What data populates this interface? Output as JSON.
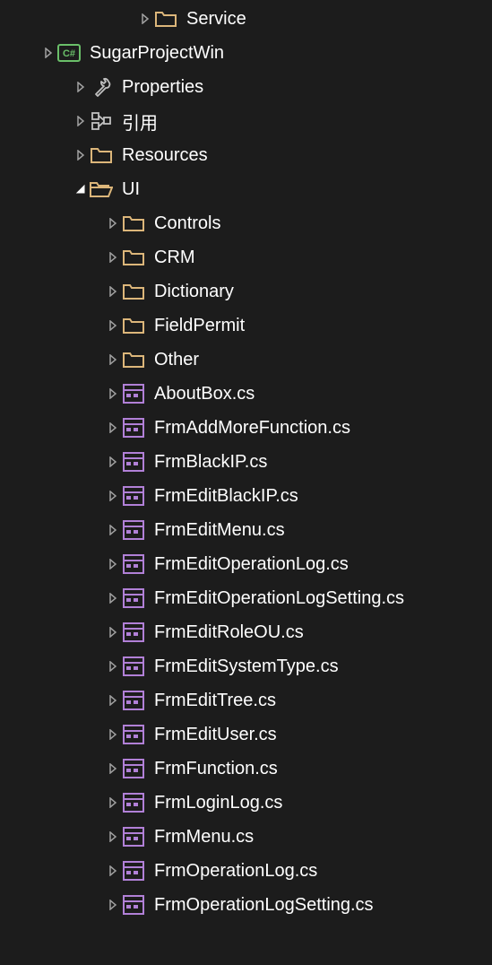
{
  "colors": {
    "folder": "#dcb67a",
    "purple": "#b180d7",
    "green": "#6abf69",
    "gray": "#c0c0c0",
    "white": "#ffffff",
    "arrow": "#a0a0a0"
  },
  "tree": [
    {
      "indent": 4,
      "expander": "right",
      "icon": "folder",
      "label": "Service",
      "name": "folder-service"
    },
    {
      "indent": 1,
      "expander": "right",
      "icon": "csproj",
      "label": "SugarProjectWin",
      "name": "project-sugarprojectwin"
    },
    {
      "indent": 2,
      "expander": "right",
      "icon": "wrench",
      "label": "Properties",
      "name": "folder-properties"
    },
    {
      "indent": 2,
      "expander": "right",
      "icon": "references",
      "label": "引用",
      "name": "folder-references"
    },
    {
      "indent": 2,
      "expander": "right",
      "icon": "folder",
      "label": "Resources",
      "name": "folder-resources"
    },
    {
      "indent": 2,
      "expander": "down",
      "icon": "folder-open",
      "label": "UI",
      "name": "folder-ui"
    },
    {
      "indent": 3,
      "expander": "right",
      "icon": "folder",
      "label": "Controls",
      "name": "folder-controls"
    },
    {
      "indent": 3,
      "expander": "right",
      "icon": "folder",
      "label": "CRM",
      "name": "folder-crm"
    },
    {
      "indent": 3,
      "expander": "right",
      "icon": "folder",
      "label": "Dictionary",
      "name": "folder-dictionary"
    },
    {
      "indent": 3,
      "expander": "right",
      "icon": "folder",
      "label": "FieldPermit",
      "name": "folder-fieldpermit"
    },
    {
      "indent": 3,
      "expander": "right",
      "icon": "folder",
      "label": "Other",
      "name": "folder-other"
    },
    {
      "indent": 3,
      "expander": "right",
      "icon": "form",
      "label": "AboutBox.cs",
      "name": "file-aboutbox"
    },
    {
      "indent": 3,
      "expander": "right",
      "icon": "form",
      "label": "FrmAddMoreFunction.cs",
      "name": "file-frmaddmorefunction"
    },
    {
      "indent": 3,
      "expander": "right",
      "icon": "form",
      "label": "FrmBlackIP.cs",
      "name": "file-frmblackip"
    },
    {
      "indent": 3,
      "expander": "right",
      "icon": "form",
      "label": "FrmEditBlackIP.cs",
      "name": "file-frmeditblackip"
    },
    {
      "indent": 3,
      "expander": "right",
      "icon": "form",
      "label": "FrmEditMenu.cs",
      "name": "file-frmeditmenu"
    },
    {
      "indent": 3,
      "expander": "right",
      "icon": "form",
      "label": "FrmEditOperationLog.cs",
      "name": "file-frmeditoperationlog"
    },
    {
      "indent": 3,
      "expander": "right",
      "icon": "form",
      "label": "FrmEditOperationLogSetting.cs",
      "name": "file-frmeditoperationlogsetting"
    },
    {
      "indent": 3,
      "expander": "right",
      "icon": "form",
      "label": "FrmEditRoleOU.cs",
      "name": "file-frmeditroleou"
    },
    {
      "indent": 3,
      "expander": "right",
      "icon": "form",
      "label": "FrmEditSystemType.cs",
      "name": "file-frmeditsystemtype"
    },
    {
      "indent": 3,
      "expander": "right",
      "icon": "form",
      "label": "FrmEditTree.cs",
      "name": "file-frmedittree"
    },
    {
      "indent": 3,
      "expander": "right",
      "icon": "form",
      "label": "FrmEditUser.cs",
      "name": "file-frmedituser"
    },
    {
      "indent": 3,
      "expander": "right",
      "icon": "form",
      "label": "FrmFunction.cs",
      "name": "file-frmfunction"
    },
    {
      "indent": 3,
      "expander": "right",
      "icon": "form",
      "label": "FrmLoginLog.cs",
      "name": "file-frmloginlog"
    },
    {
      "indent": 3,
      "expander": "right",
      "icon": "form",
      "label": "FrmMenu.cs",
      "name": "file-frmmenu"
    },
    {
      "indent": 3,
      "expander": "right",
      "icon": "form",
      "label": "FrmOperationLog.cs",
      "name": "file-frmoperationlog"
    },
    {
      "indent": 3,
      "expander": "right",
      "icon": "form",
      "label": "FrmOperationLogSetting.cs",
      "name": "file-frmoperationlogsetting"
    }
  ]
}
